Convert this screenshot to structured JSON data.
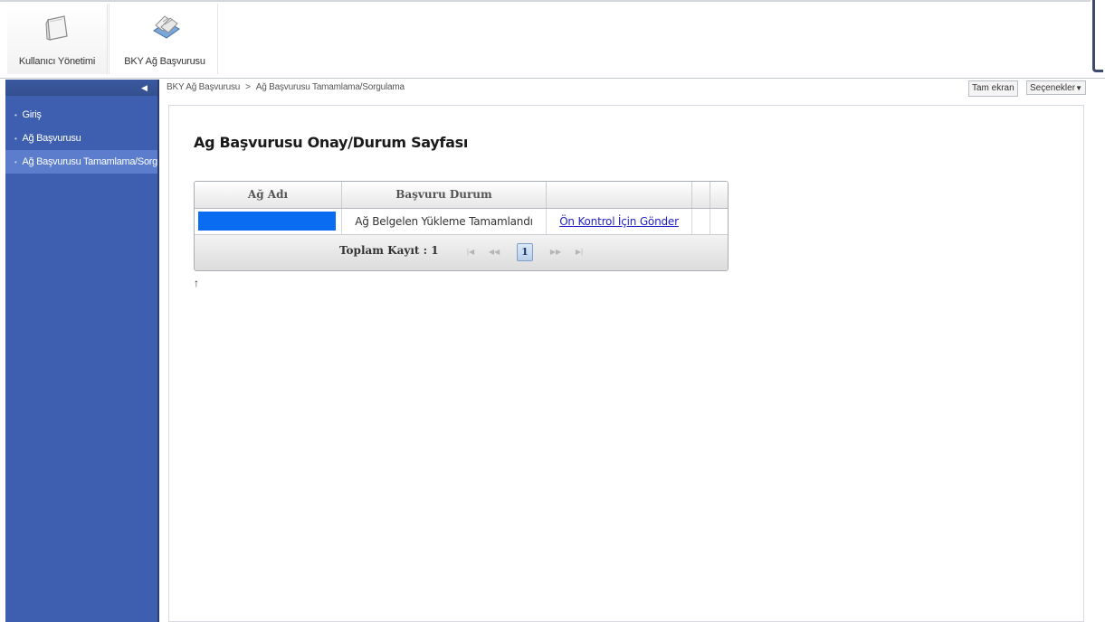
{
  "ribbon": {
    "buttons": [
      {
        "label": "Kullanıcı Yönetimi",
        "icon": "folder-icon"
      },
      {
        "label": "BKY Ağ Başvurusu",
        "icon": "documents-icon"
      }
    ]
  },
  "sidebar": {
    "collapse_glyph": "◀",
    "items": [
      {
        "label": "Giriş"
      },
      {
        "label": "Ağ Başvurusu"
      },
      {
        "label": "Ağ Başvurusu Tamamlama/Sorgulama",
        "active": true
      }
    ]
  },
  "breadcrumb": {
    "root": "BKY Ağ Başvurusu",
    "separator": ">",
    "current": "Ağ Başvurusu Tamamlama/Sorgulama"
  },
  "toolbar": {
    "fullscreen_label": "Tam ekran",
    "options_label": "Seçenekler"
  },
  "page": {
    "title": "Ag Başvurusu Onay/Durum Sayfası",
    "footnote_glyph": "↑"
  },
  "grid": {
    "columns": [
      "Ağ Adı",
      "Başvuru Durum",
      "",
      "",
      ""
    ],
    "rows": [
      {
        "name": "",
        "status": "Ağ Belgelen Yükleme Tamamlandı",
        "action": "Ön Kontrol İçin Gönder"
      }
    ],
    "pager": {
      "total_label": "Toplam Kayıt : 1",
      "current_page": "1",
      "first": "|◀",
      "prev": "◀◀",
      "next": "▶▶",
      "last": "▶|"
    }
  },
  "colors": {
    "sidebar_bg": "#3e5fb0",
    "sidebar_active": "#5c7dcc",
    "redaction": "#0a6cf0",
    "link": "#1f1fc8"
  }
}
